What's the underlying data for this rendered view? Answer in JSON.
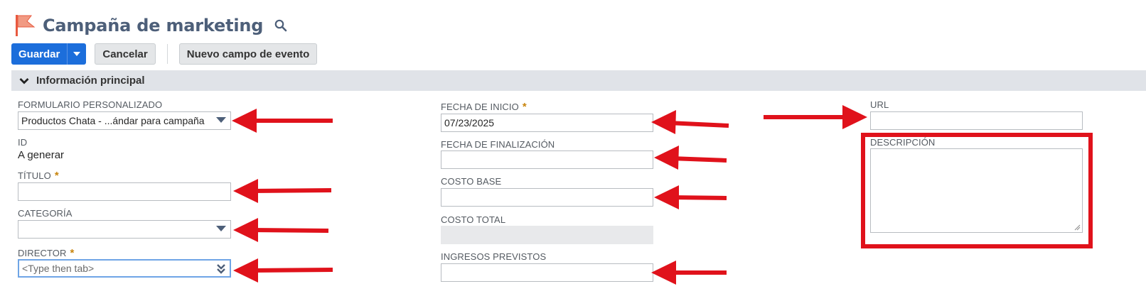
{
  "header": {
    "title": "Campaña de marketing",
    "flag_icon": "flag-icon",
    "search_icon": "search-icon"
  },
  "toolbar": {
    "save_label": "Guardar",
    "cancel_label": "Cancelar",
    "new_event_field_label": "Nuevo campo de evento"
  },
  "section": {
    "title": "Información principal"
  },
  "fields": {
    "custom_form": {
      "label": "FORMULARIO PERSONALIZADO",
      "value": "Productos Chata - ...ándar para campaña"
    },
    "id": {
      "label": "ID",
      "value": "A generar"
    },
    "title": {
      "label": "TÍTULO",
      "required_mark": "*",
      "value": ""
    },
    "category": {
      "label": "CATEGORÍA",
      "value": ""
    },
    "director": {
      "label": "DIRECTOR",
      "required_mark": "*",
      "placeholder": "<Type then tab>"
    },
    "start_date": {
      "label": "FECHA DE INICIO",
      "required_mark": "*",
      "value": "07/23/2025"
    },
    "end_date": {
      "label": "FECHA DE FINALIZACIÓN",
      "value": ""
    },
    "base_cost": {
      "label": "COSTO BASE",
      "value": ""
    },
    "total_cost": {
      "label": "COSTO TOTAL",
      "value": ""
    },
    "expected_revenue": {
      "label": "INGRESOS PREVISTOS",
      "value": ""
    },
    "url": {
      "label": "URL",
      "value": ""
    },
    "description": {
      "label": "DESCRIPCIÓN",
      "value": ""
    }
  },
  "colors": {
    "primary_button": "#1c6edb",
    "title": "#4d5f79",
    "section_bg": "#e0e3e8",
    "required": "#c8850e",
    "annotation": "#e0121b"
  }
}
